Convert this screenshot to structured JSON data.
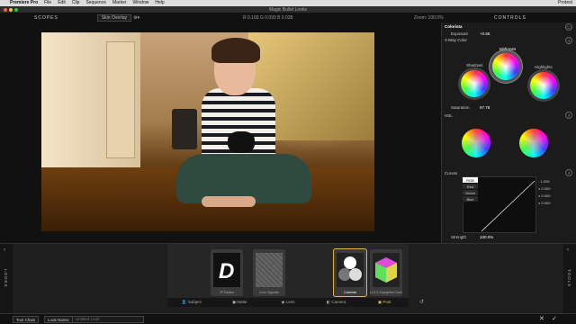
{
  "menubar": {
    "app": "Premiere Pro",
    "items": [
      "File",
      "Edit",
      "Clip",
      "Sequence",
      "Marker",
      "Window",
      "Help"
    ],
    "right": "Protest"
  },
  "window": {
    "title": "Magic Bullet Looks"
  },
  "topbar": {
    "scopes_title": "SCOPES",
    "skin_overlay": "Skin Overlay",
    "readout": "R 0.168  G 0.093  B 0.038",
    "zoom": "Zoom: 100.0%",
    "controls_title": "CONTROLS"
  },
  "controls": {
    "tool_name": "Colorista",
    "exposure_label": "Exposure",
    "exposure_value": "+0.65",
    "threeway_label": "3-Way Color",
    "shadows_label": "Shadows",
    "midtones_label": "Midtones",
    "highlights_label": "Highlights",
    "saturation_label": "Saturation",
    "saturation_value": "97.78",
    "hsl_label": "HSL",
    "curves_label": "Curves",
    "channels": [
      "RGB",
      "Red",
      "Green",
      "Blue"
    ],
    "curve_values": [
      "1.000",
      "0.000",
      "0.000",
      "0.000"
    ],
    "strength_label": "Strength",
    "strength_value": "100.0%"
  },
  "lower": {
    "looks_tab": "LOOKS",
    "tools_tab": "TOOLS",
    "tools": [
      {
        "name": "2P Radius"
      },
      {
        "name": "Lens Vignette"
      },
      {
        "name": "Colorista"
      },
      {
        "name": "LUT 6 Evangelist Common 2"
      }
    ],
    "tabs": [
      "Subject",
      "Matte",
      "Lens",
      "Camera",
      "Post"
    ],
    "active_tab": "Post"
  },
  "bottombar": {
    "tool_chain": "Tool Chain",
    "look_name_label": "Look Name:",
    "look_name_placeholder": "Untitled Look"
  },
  "colors": {
    "accent": "#e8b54a"
  }
}
